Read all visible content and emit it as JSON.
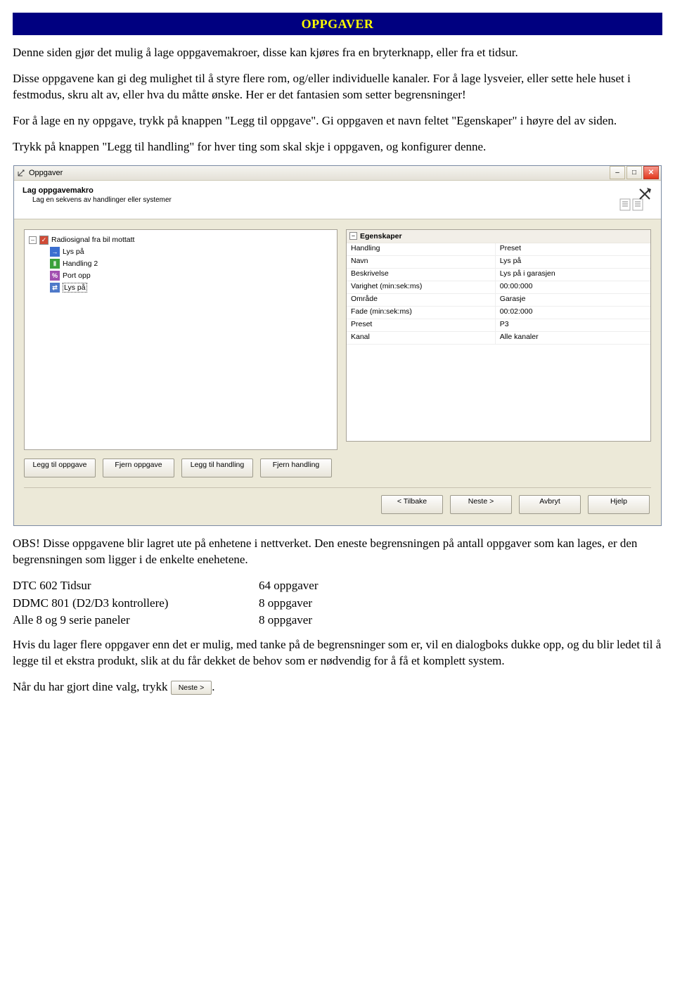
{
  "header": {
    "title": "OPPGAVER"
  },
  "paragraphs": {
    "p1": "Denne siden gjør det mulig å lage oppgavemakroer, disse kan kjøres fra en bryterknapp, eller fra et tidsur.",
    "p2": "Disse oppgavene kan gi deg mulighet til å styre flere rom, og/eller individuelle kanaler. For å lage lysveier, eller sette hele huset i festmodus, skru alt av, eller hva du måtte ønske. Her er det fantasien som setter begrensninger!",
    "p3": "For å lage en ny oppgave, trykk på knappen \"Legg til oppgave\". Gi oppgaven et navn feltet \"Egenskaper\" i høyre del av siden.",
    "p4": "Trykk på knappen \"Legg til handling\" for hver ting som skal skje i oppgaven, og konfigurer denne."
  },
  "dialog": {
    "title": "Oppgaver",
    "wizard_title": "Lag oppgavemakro",
    "wizard_sub": "Lag en sekvens av handlinger eller systemer",
    "tree": {
      "root_label": "Radiosignal fra bil mottatt",
      "children": [
        {
          "icon": "arrow",
          "color": "blue",
          "label": "Lys på"
        },
        {
          "icon": "pause",
          "color": "green",
          "label": "Handling 2"
        },
        {
          "icon": "percent",
          "color": "purple",
          "label": "Port opp"
        },
        {
          "icon": "arrow2",
          "color": "blue2",
          "label": "Lys på",
          "selected": true
        }
      ]
    },
    "props": {
      "header": "Egenskaper",
      "rows": [
        {
          "k": "Handling",
          "v": "Preset"
        },
        {
          "k": "Navn",
          "v": "Lys på"
        },
        {
          "k": "Beskrivelse",
          "v": "Lys på i garasjen"
        },
        {
          "k": "Varighet (min:sek:ms)",
          "v": "00:00:000"
        },
        {
          "k": "Område",
          "v": "Garasje"
        },
        {
          "k": "Fade (min:sek:ms)",
          "v": "00:02:000"
        },
        {
          "k": "Preset",
          "v": "P3"
        },
        {
          "k": "Kanal",
          "v": "Alle kanaler"
        }
      ]
    },
    "buttons": {
      "add_task": "Legg til oppgave",
      "remove_task": "Fjern oppgave",
      "add_action": "Legg til handling",
      "remove_action": "Fjern handling",
      "back": "< Tilbake",
      "next": "Neste >",
      "cancel": "Avbryt",
      "help": "Hjelp"
    }
  },
  "after": {
    "obs": "OBS! Disse oppgavene blir lagret ute på enhetene i nettverket. Den eneste begrensningen på antall oppgaver som kan lages, er den begrensningen som ligger i de enkelte enehetene.",
    "limits": [
      {
        "name": "DTC 602 Tidsur",
        "value": "64 oppgaver"
      },
      {
        "name": "DDMC 801 (D2/D3 kontrollere)",
        "value": "8 oppgaver"
      },
      {
        "name": "Alle 8 og 9 serie paneler",
        "value": "8 oppgaver"
      }
    ],
    "warn": "Hvis du lager flere oppgaver enn det er mulig, med tanke på de begrensninger som er, vil en dialogboks dukke opp, og du blir ledet til å legge til et ekstra produkt, slik at du får dekket de behov som er nødvendig for å få et komplett system.",
    "final_prefix": "Når du har gjort dine valg, trykk",
    "final_btn": "Neste >",
    "final_suffix": "."
  }
}
